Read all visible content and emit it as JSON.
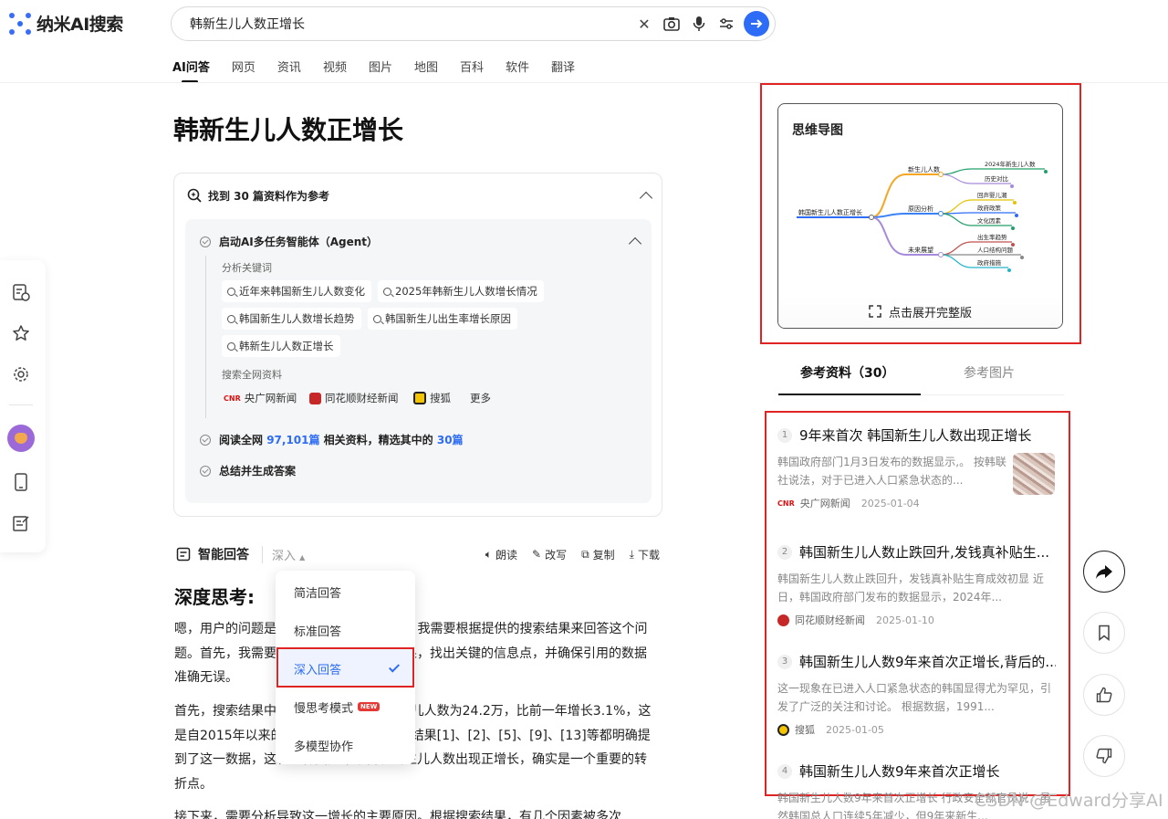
{
  "app": {
    "logo_text": "纳米AI搜索"
  },
  "search": {
    "query": "韩新生儿人数正增长"
  },
  "nav": [
    "AI问答",
    "网页",
    "资讯",
    "视频",
    "图片",
    "地图",
    "百科",
    "软件",
    "翻译"
  ],
  "main": {
    "title": "韩新生儿人数正增长",
    "refs_found": "找到 30 篇资料作为参考",
    "agent_step": "启动AI多任务智能体（Agent）",
    "keywords_label": "分析关键词",
    "keywords": [
      "近年来韩国新生儿人数变化",
      "2025年韩新生儿人数增长情况",
      "韩国新生儿人数增长趋势",
      "韩国新生儿出生率增长原因",
      "韩新生儿人数正增长"
    ],
    "sources_label": "搜索全网资料",
    "sources": [
      "央广网新闻",
      "同花顺财经新闻",
      "搜狐",
      "更多"
    ],
    "read_step": {
      "prefix": "阅读全网 ",
      "total": "97,101篇",
      "middle": " 相关资料，精选其中的 ",
      "selected": "30篇"
    },
    "summary_step": "总结并生成答案",
    "answer_label": "智能回答",
    "answer_mode": "深入",
    "tools": [
      "朗读",
      "改写",
      "复制",
      "下载"
    ],
    "deep_heading": "深度思考:",
    "para1": "嗯，用户的问题是“韩新生儿人数正增长”，我需要根据提供的搜索结果来回答这个问题。首先，我需要仔细阅读提供的搜索结果，找出关键的信息点，并确保引用的数据准确无误。",
    "para2": "首先，搜索结果中提到，2024年韩国新生儿人数为24.2万，比前一年增长3.1%，这是自2015年以来的首次增长。例如，搜索结果[1]、[2]、[5]、[9]、[13]等都明确提到了这一数据，这表明韩国九年来首次新生儿人数出现正增长，确实是一个重要的转折点。",
    "para3": "接下来，需要分析导致这一增长的主要原因。根据搜索结果，有几个因素被多次"
  },
  "dropdown": {
    "items": [
      "简洁回答",
      "标准回答",
      "深入回答",
      "慢思考模式",
      "多模型协作"
    ],
    "selected_index": 2,
    "new_badge": "NEW"
  },
  "mindmap": {
    "title": "思维导图",
    "root": "韩国新生儿人数正增长",
    "branches": [
      {
        "label": "新生儿人数",
        "children": [
          "2024年新生儿人数",
          "历史对比"
        ]
      },
      {
        "label": "原因分析",
        "children": [
          "回声婴儿潮",
          "政府政策",
          "文化因素"
        ]
      },
      {
        "label": "未来展望",
        "children": [
          "出生率趋势",
          "人口结构问题",
          "政府措施"
        ]
      }
    ],
    "expand_label": "点击展开完整版"
  },
  "right_tabs": [
    "参考资料（30）",
    "参考图片"
  ],
  "references": [
    {
      "num": "1",
      "title": "9年来首次 韩国新生儿人数出现正增长",
      "desc": "韩国政府部门1月3日发布的数据显示,。 按韩联社说法，对于已进入人口紧急状态的...",
      "source": "央广网新闻",
      "date": "2025-01-04"
    },
    {
      "num": "2",
      "title": "韩国新生儿人数止跌回升,发钱真补贴生...",
      "desc": "韩国新生儿人数止跌回升，发钱真补贴生育成效初显 近日，韩国政府部门发布的数据显示，2024年...",
      "source": "同花顺财经新闻",
      "date": "2025-01-10"
    },
    {
      "num": "3",
      "title": "韩国新生儿人数9年来首次正增长,背后的...",
      "desc": "这一现象在已进入人口紧急状态的韩国显得尤为罕见，引发了广泛的关注和讨论。 根据数据，1991...",
      "source": "搜狐",
      "date": "2025-01-05"
    },
    {
      "num": "4",
      "title": "韩国新生儿人数9年来首次正增长",
      "desc": "韩国新生儿人数9年来首次正增长 行政安全部官员说，虽然韩国总人口连续5年减少，但9年来新生...",
      "source": "",
      "date": ""
    }
  ],
  "watermark": "CSDN @Edward分享AI"
}
